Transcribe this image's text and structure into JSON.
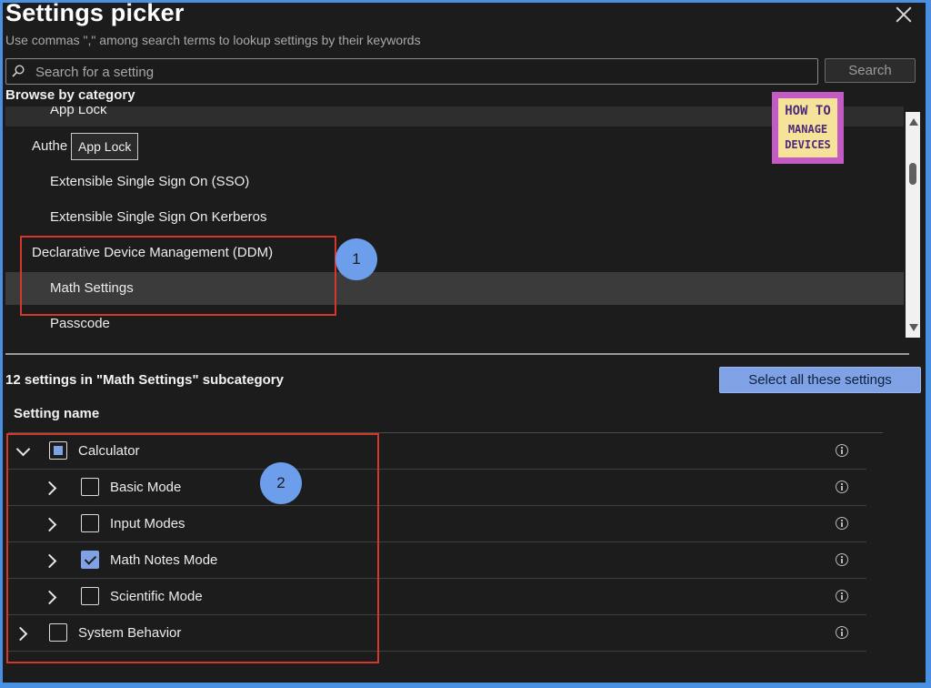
{
  "header": {
    "title": "Settings picker",
    "subtitle": "Use commas \",\" among search terms to lookup settings by their keywords"
  },
  "search": {
    "placeholder": "Search for a setting",
    "button_label": "Search"
  },
  "browse": {
    "label": "Browse by category",
    "items": [
      {
        "label": "App Lock",
        "level": 2
      },
      {
        "label": "Authe",
        "level": 1
      },
      {
        "label": "Extensible Single Sign On (SSO)",
        "level": 2
      },
      {
        "label": "Extensible Single Sign On Kerberos",
        "level": 2
      },
      {
        "label": "Declarative Device Management (DDM)",
        "level": 1
      },
      {
        "label": "Math Settings",
        "level": 2,
        "selected": true
      },
      {
        "label": "Passcode",
        "level": 2
      }
    ],
    "tooltip": "App Lock"
  },
  "logo": {
    "line1": "HOW TO",
    "line2": "MANAGE",
    "line3": "DEVICES"
  },
  "subcategory": {
    "header": "12 settings in \"Math Settings\" subcategory",
    "select_all_label": "Select all these settings",
    "column_header": "Setting name"
  },
  "settings": [
    {
      "label": "Calculator",
      "expanded": true,
      "state": "partial"
    },
    {
      "label": "Basic Mode",
      "expanded": false,
      "state": "unchecked"
    },
    {
      "label": "Input Modes",
      "expanded": false,
      "state": "unchecked"
    },
    {
      "label": "Math Notes Mode",
      "expanded": false,
      "state": "checked"
    },
    {
      "label": "Scientific Mode",
      "expanded": false,
      "state": "unchecked"
    },
    {
      "label": "System Behavior",
      "expanded": false,
      "state": "unchecked"
    }
  ],
  "annotations": {
    "badge1": "1",
    "badge2": "2",
    "box_color": "#d4382c",
    "badge_color": "#6d9eeb"
  },
  "colors": {
    "background": "#1c1c1c",
    "frame": "#4a90e2",
    "accent": "#7fa2e6"
  }
}
